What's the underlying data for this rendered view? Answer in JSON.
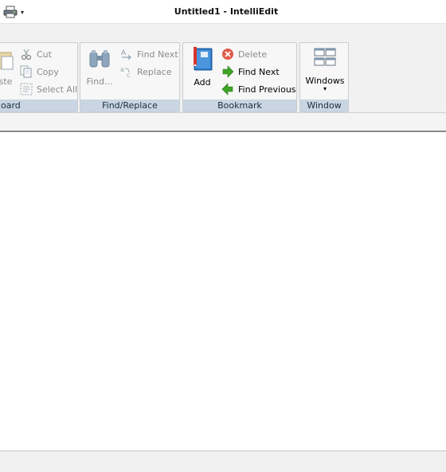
{
  "window": {
    "title": "Untitled1 - IntelliEdit"
  },
  "quick_access": {
    "print_icon": "print-icon",
    "dropdown_glyph": "▾"
  },
  "ribbon": {
    "clipboard": {
      "label": "oard",
      "paste_label": "ste",
      "cut_label": "Cut",
      "copy_label": "Copy",
      "select_all_label": "Select All"
    },
    "find_replace": {
      "label": "Find/Replace",
      "find_label": "Find...",
      "find_next_label": "Find Next",
      "replace_label": "Replace"
    },
    "bookmark": {
      "label": "Bookmark",
      "add_label": "Add",
      "delete_label": "Delete",
      "find_next_label": "Find Next",
      "find_previous_label": "Find Previous"
    },
    "window": {
      "label": "Window",
      "windows_label": "Windows",
      "dropdown_glyph": "▾"
    }
  },
  "colors": {
    "group_label_bg": "#c9d5e3",
    "disabled_text": "#8b8b8b",
    "delete_red": "#e05a4a",
    "arrow_green": "#3fa326",
    "bookmark_blue": "#2b78c5"
  }
}
